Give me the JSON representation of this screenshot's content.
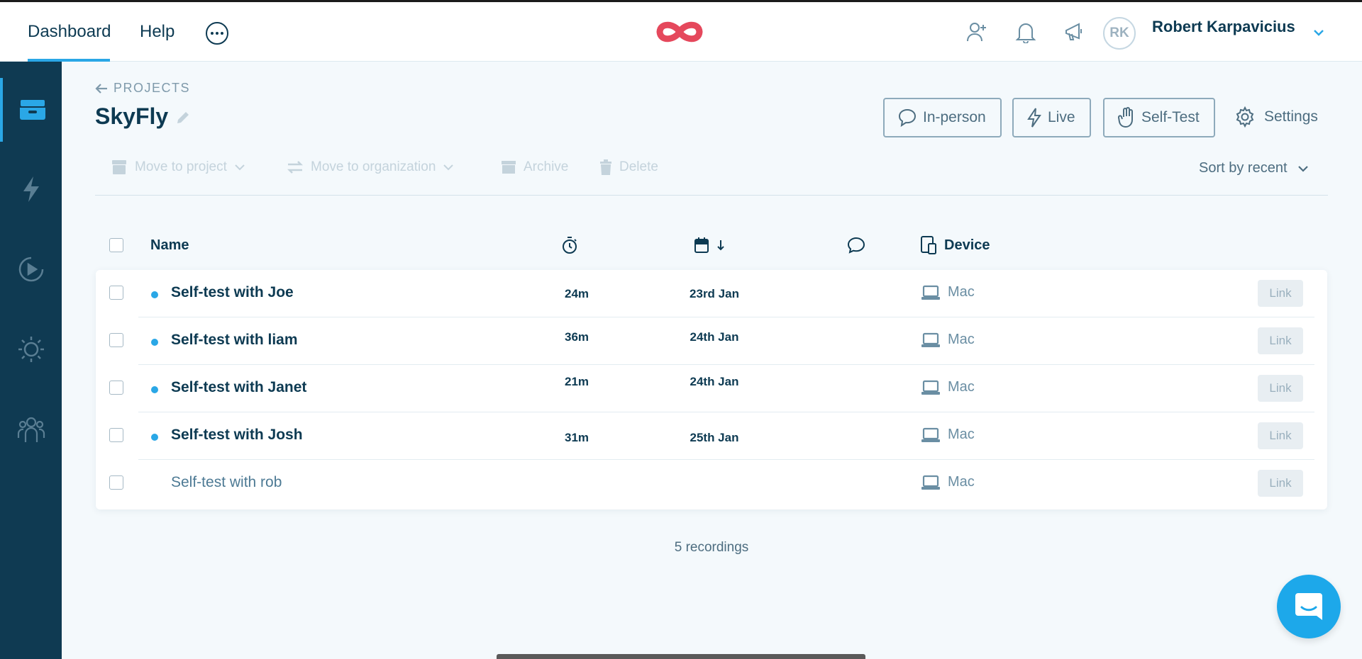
{
  "nav": {
    "dashboard": "Dashboard",
    "help": "Help"
  },
  "user": {
    "initials": "RK",
    "name": "Robert Karpavicius"
  },
  "breadcrumb": {
    "back_label": "PROJECTS"
  },
  "project": {
    "title": "SkyFly"
  },
  "modes": {
    "in_person": "In-person",
    "live": "Live",
    "self_test": "Self-Test",
    "settings": "Settings"
  },
  "toolbar": {
    "move_project": "Move to project",
    "move_org": "Move to organization",
    "archive": "Archive",
    "delete": "Delete",
    "sort": "Sort by recent"
  },
  "table": {
    "headers": {
      "name": "Name",
      "device": "Device"
    },
    "rows": [
      {
        "name": "Self-test with Joe",
        "duration": "24m",
        "date": "23rd Jan",
        "device": "Mac",
        "link": "Link",
        "unread": true
      },
      {
        "name": "Self-test with liam",
        "duration": "36m",
        "date": "24th Jan",
        "device": "Mac",
        "link": "Link",
        "unread": true
      },
      {
        "name": "Self-test with Janet",
        "duration": "21m",
        "date": "24th Jan",
        "device": "Mac",
        "link": "Link",
        "unread": true
      },
      {
        "name": "Self-test with Josh",
        "duration": "31m",
        "date": "25th Jan",
        "device": "Mac",
        "link": "Link",
        "unread": true
      },
      {
        "name": "Self-test with rob",
        "duration": "",
        "date": "",
        "device": "Mac",
        "link": "Link",
        "unread": false
      }
    ]
  },
  "footer": {
    "count": "5 recordings"
  },
  "colors": {
    "accent": "#2aa7e6",
    "sidebar": "#0f3a52",
    "logo": "#e5485c",
    "text": "#0d3a52"
  },
  "icons": [
    "more-icon",
    "infinity-logo",
    "add-user-icon",
    "bell-icon",
    "megaphone-icon",
    "chevron-down-icon",
    "archive-box-icon",
    "lightning-icon",
    "play-icon",
    "sun-icon",
    "team-icon",
    "arrow-left-icon",
    "pencil-icon",
    "speech-bubble-icon",
    "hand-icon",
    "gear-icon",
    "timer-icon",
    "calendar-icon",
    "arrow-down-icon",
    "comment-icon",
    "device-icon",
    "laptop-icon",
    "chat-icon"
  ]
}
